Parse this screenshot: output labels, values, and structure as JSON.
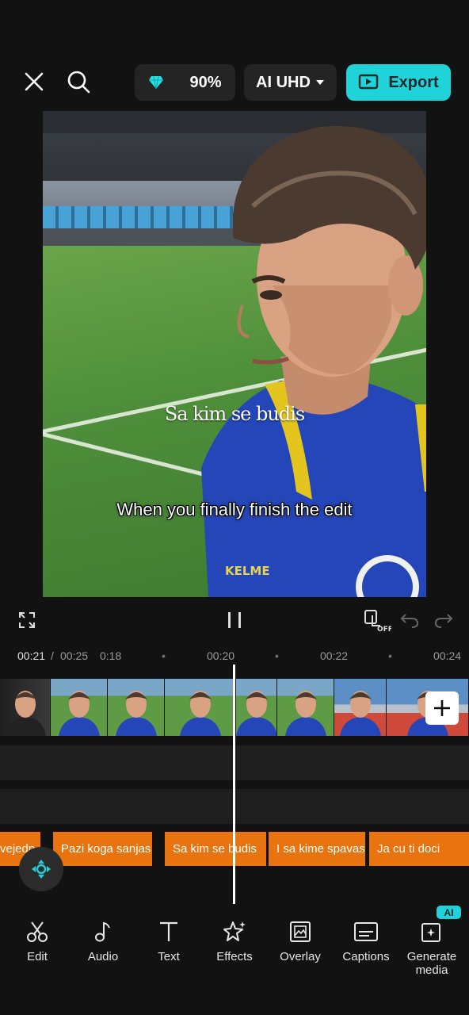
{
  "topbar": {
    "credits_value": "90%",
    "quality_label": "AI UHD",
    "export_label": "Export"
  },
  "preview": {
    "overlay_text": "Sa kim se budis",
    "caption_text": "When you finally finish the edit",
    "jersey_brand": "KELME"
  },
  "controls": {
    "duplicate_state": "OFF"
  },
  "timeline": {
    "current_time": "00:21",
    "total_time": "00:25",
    "ticks": [
      "0:18",
      "00:20",
      "00:22",
      "00:24"
    ],
    "text_clips": [
      "vejedn",
      "Pazi koga sanjas",
      "Sa kim se budis",
      "I sa kime spavas",
      "Ja cu ti doci"
    ]
  },
  "toolbar": {
    "items": [
      {
        "label": "Edit",
        "icon": "scissors-icon"
      },
      {
        "label": "Audio",
        "icon": "music-note-icon"
      },
      {
        "label": "Text",
        "icon": "text-icon"
      },
      {
        "label": "Effects",
        "icon": "sparkle-star-icon"
      },
      {
        "label": "Overlay",
        "icon": "overlay-image-icon"
      },
      {
        "label": "Captions",
        "icon": "captions-icon"
      },
      {
        "label": "Generate media",
        "icon": "generate-media-icon"
      }
    ],
    "ai_badge": "AI"
  },
  "colors": {
    "accent": "#1fd3d9",
    "text_track": "#e8730f",
    "background": "#121212"
  }
}
